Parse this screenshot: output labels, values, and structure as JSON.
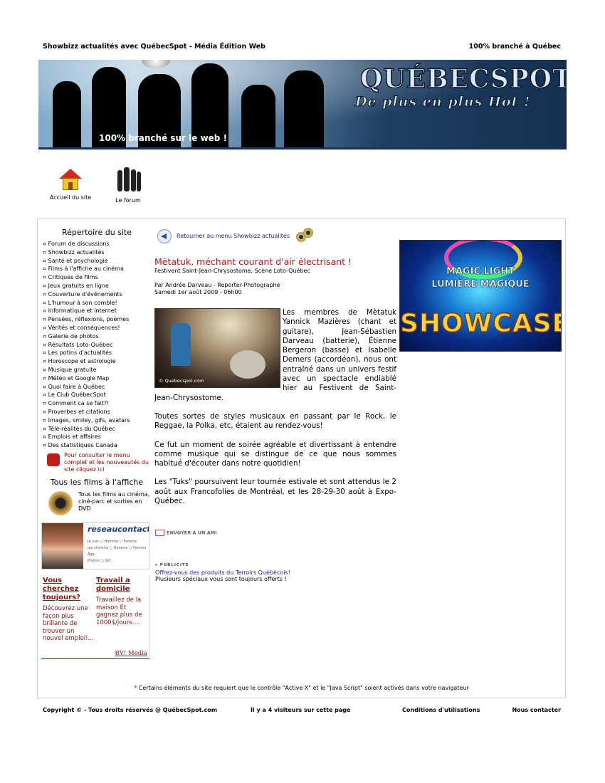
{
  "header": {
    "left": "Showbizz actualités avec QuébecSpot - Média Édition Web",
    "right": "100% branché à Québec"
  },
  "banner": {
    "brand": "QUÉBECSPOT",
    "slogan": "De plus en plus Hot !",
    "tagline": "100% branché sur le web !"
  },
  "nav": {
    "home_label": "Accueil du site",
    "forum_label": "Le forum"
  },
  "sidebar": {
    "title": "Répertoire du site",
    "items": [
      "Forum de discussions",
      "Showbizz actualités",
      "Santé et psychologie",
      "Films à l'affiche au cinéma",
      "Critiques de films",
      "Jeux gratuits en ligne",
      "Couverture d'événements",
      "L'humour à son comble!",
      "Informatique et internet",
      "Pensées, réflexions, poèmes",
      "Vérités et conséquences!",
      "Galerie de photos",
      "Résultats Loto-Québec",
      "Les potins d'actualités",
      "Horoscope et astrologie",
      "Musique gratuite",
      "Météo et Google Map",
      "Quoi faire à Québec",
      "Le Club QuébecSpot",
      "Comment ca se fait?!",
      "Proverbes et citations",
      "Images, smiley, gifs, avatars",
      "Télé-réalités du Québec",
      "Emplois et affaires",
      "Des statistiques Canada"
    ],
    "menu_note": "Pour consulter le menu complet et les nouveautés du site cliquez ici",
    "films_title": "Tous les films à l'affiche",
    "films_text": "Tous les films au cinéma, ciné-parc et sorties en DVD"
  },
  "ads": {
    "rc_logo": "reseaucontact.com",
    "rc_form": [
      "Je suis  ○ Homme ○ Femme",
      "qui cherche ○ Homme ○ Femme",
      "Âge",
      "Photos ○  GO"
    ],
    "col1_title": "Vous cherchez toujours?",
    "col1_body": "Découvrez une façon plus brillante de trouver un nouvel emploi!...",
    "col2_title": "Travail a domicile",
    "col2_body": "Travaillez de la maison Et gagnez plus de 1000$/jours....",
    "bv": "BV! Media"
  },
  "article": {
    "back_link": "Retourner au menu Showbizz actualités",
    "title": "Mètatuk, méchant courant d'air électrisant !",
    "subtitle": "Festivent Saint-Jean-Chrysostome, Scène Loto-Québec",
    "author": "Par Andrée Darveau - Reporter-Photographe",
    "date": "Samedi 1er août 2009 - 06h00",
    "photo_caption": "© Quebecspot.com",
    "paragraphs": [
      "Les membres de Mètatuk Yannick Mazières (chant et guitare), Jean-Sébastien Darveau (batterie), Étienne Bergeron (basse) et Isabelle Demers (accordéon), nous ont entraîné dans un univers festif avec un spectacle endiablé hier au Festivent de Saint-Jean-Chrysostome.",
      "Toutes sortes de styles musicaux en passant par le Rock, le Reggae, la Polka, etc, étaient au rendez-vous!",
      "Ce fut un moment de soirée agréable et divertissant à entendre comme musique qui se distingue de ce que nous sommes habitué d'écouter dans notre quotidien!",
      "Les \"Tuks\" poursuivent leur tournée estivale et sont attendus le 2 août aux Francofolies de Montréal, et les 28-29-30 août à Expo-Québec."
    ],
    "send_label": "ENVOYER À UN AMI"
  },
  "publicite": {
    "tag": "PUBLICITE",
    "link": "Offrez-vous des produits du Terroirs Québécois!",
    "text": "Plusieurs spéciaux vous sont toujours offerts !"
  },
  "showcase": {
    "line1": "MAGIC LIGHT",
    "line2": "LUMIÈRE MAGIQUE",
    "line3": "SHOWCASE"
  },
  "notice": {
    "star": "*",
    "text": "Certains éléments du site requiert que le contrôle \"Active X\" et le \"Java Script\" soient activés dans votre navigateur"
  },
  "footer": {
    "copyright": "Copyright © - Tous droits réservés @ QuébecSpot.com",
    "visitors": "Il y a 4 visiteurs sur cette page",
    "conditions": "Conditions d'utilisations",
    "contact": "Nous contacter"
  }
}
